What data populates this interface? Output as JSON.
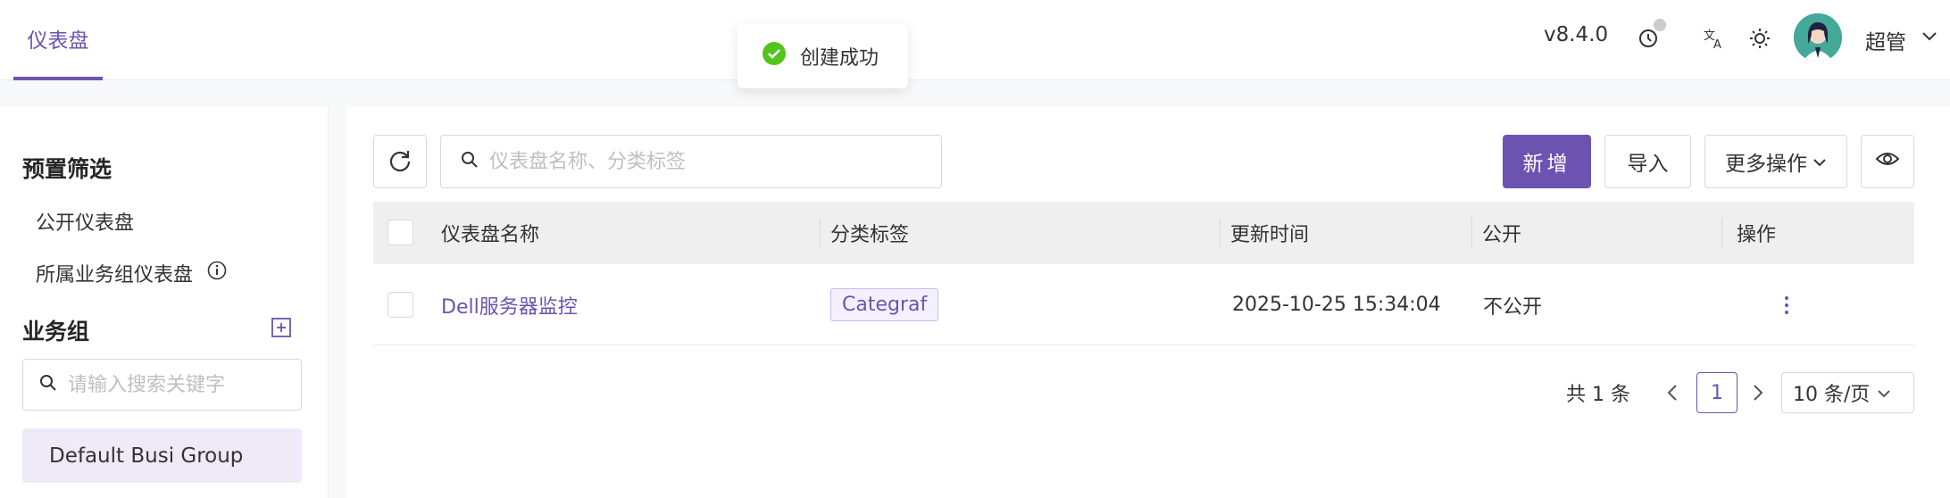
{
  "header": {
    "tab_label": "仪表盘",
    "version": "v8.4.0",
    "user_name": "超管",
    "icons": [
      "history-icon",
      "translate-icon",
      "theme-sun-icon",
      "user-avatar",
      "chevron-down-icon"
    ]
  },
  "toast": {
    "message": "创建成功",
    "icon": "success-check-icon",
    "color": "#52c41a"
  },
  "sidebar": {
    "preset_title": "预置筛选",
    "items": [
      {
        "label": "公开仪表盘"
      },
      {
        "label": "所属业务组仪表盘"
      }
    ],
    "group_title": "业务组",
    "search_placeholder": "请输入搜索关键字",
    "groups": [
      {
        "label": "Default Busi Group"
      }
    ]
  },
  "toolbar": {
    "search_placeholder": "仪表盘名称、分类标签",
    "new_label": "新增",
    "import_label": "导入",
    "more_label": "更多操作"
  },
  "table": {
    "columns": [
      "仪表盘名称",
      "分类标签",
      "更新时间",
      "公开",
      "操作"
    ],
    "rows": [
      {
        "name": "Dell服务器监控",
        "tag": "Categraf",
        "updated": "2025-10-25 15:34:04",
        "public": "不公开"
      }
    ]
  },
  "pagination": {
    "total_text": "共 1 条",
    "current_page": "1",
    "page_size": "10 条/页"
  },
  "colors": {
    "accent": "#6c53b1",
    "success": "#52c41a"
  }
}
